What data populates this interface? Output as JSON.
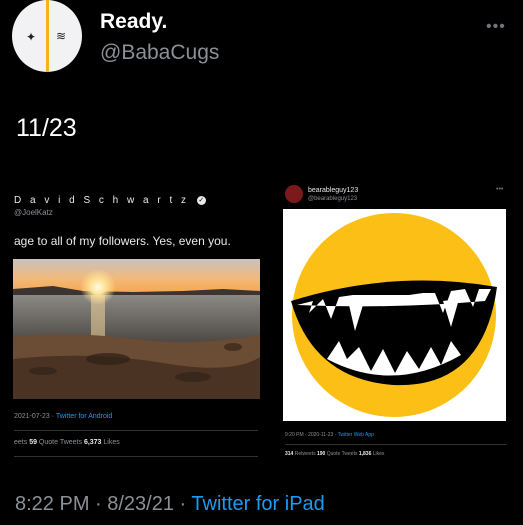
{
  "header": {
    "display_name": "Ready.",
    "handle": "@BabaCugs",
    "more_icon": "more-horizontal-icon"
  },
  "tweet": {
    "text": "11/23",
    "timestamp": "8:22 PM · 8/23/21 · ",
    "source": "Twitter for iPad"
  },
  "left_card": {
    "display_name": "D a v i d  S c h w a r t z",
    "verified_icon": "verified-badge-icon",
    "handle": "@JoelKatz",
    "text": "age to all of my followers. Yes, even you.",
    "date": "2021-07-23 · ",
    "source": "Twitter for Android",
    "stats_prefix": "eets ",
    "quote_count": "59",
    "quote_label": " Quote Tweets ",
    "likes_count": "6,373",
    "likes_label": " Likes"
  },
  "right_card": {
    "display_name": "bearableguy123",
    "handle": "@bearableguy123",
    "date": "9:20 PM · 2020-11-23 · ",
    "source": "Twitter Web App",
    "retweets_count": "314",
    "retweets_label": " Retweets ",
    "quote_count": "190",
    "quote_label": " Quote Tweets ",
    "likes_count": "1,836",
    "likes_label": " Likes"
  },
  "colors": {
    "background": "#000000",
    "link": "#1d9bf0",
    "muted": "#8b9095",
    "smiley_yellow": "#fbbf16"
  }
}
